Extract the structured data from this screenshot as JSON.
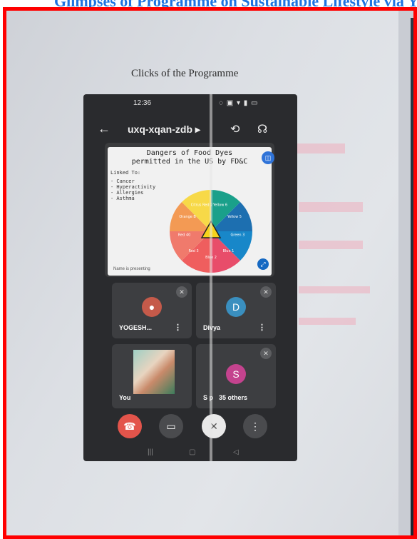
{
  "header": {
    "banner_text": "Glimpses of Programme on Sustainable Lifestyle via Yoga"
  },
  "document": {
    "caption": "Clicks of the Programme"
  },
  "phone": {
    "status": {
      "time": "12:36",
      "icons": "◌ ▣ ▾ ▮ ▭"
    },
    "call": {
      "meeting_code": "uxq-xqan-zdb ▸"
    },
    "slide": {
      "title_line1": "Dangers of Food Dyes",
      "title_line2": "permitted in the US by FD&C",
      "linked_to": "Linked To:",
      "items": [
        "- Cancer",
        "- Hyperactivity",
        "- Allergies",
        "- Asthma"
      ],
      "wheel_labels": [
        "Yellow 6",
        "Yellow 5",
        "Green 3",
        "Blue 1",
        "Blue 2",
        "Red 3",
        "Red 40",
        "Orange B",
        "Citrus Red 2"
      ],
      "caption": "Name is presenting"
    },
    "participants": [
      {
        "name": "YOGESH...",
        "more": "⋮"
      },
      {
        "name": "Divya",
        "initial": "D",
        "more": "⋮"
      },
      {
        "name": "You"
      },
      {
        "name": "S p",
        "initial": "S",
        "others": "35 others"
      }
    ]
  },
  "colors": {
    "frame": "#ff0000",
    "banner_text": "#1e73e0",
    "end_call": "#e3544b"
  }
}
